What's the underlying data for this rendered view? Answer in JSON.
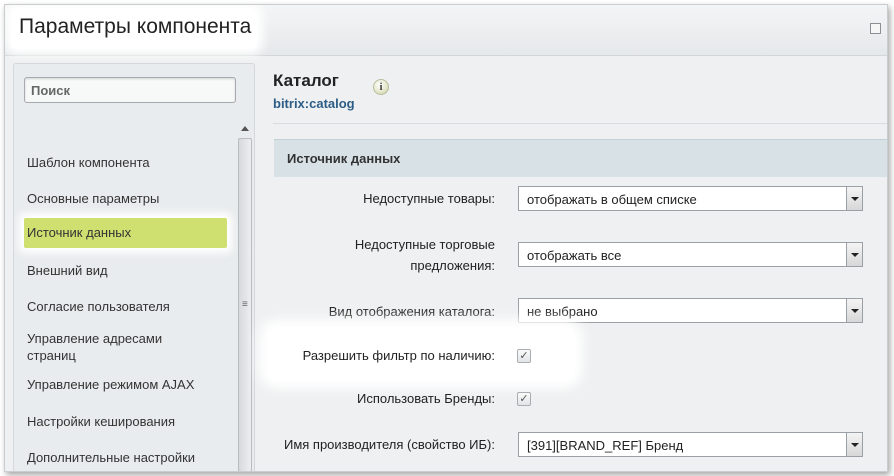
{
  "window": {
    "title": "Параметры компонента"
  },
  "sidebar": {
    "search_placeholder": "Поиск",
    "items": [
      {
        "label": "Шаблон компонента"
      },
      {
        "label": "Основные параметры"
      },
      {
        "label": "Источник данных",
        "active": true
      },
      {
        "label": "Внешний вид"
      },
      {
        "label": "Согласие пользователя"
      },
      {
        "label": "Управление адресами страниц"
      },
      {
        "label": "Управление режимом AJAX"
      },
      {
        "label": "Настройки кеширования"
      },
      {
        "label": "Дополнительные настройки"
      }
    ],
    "scroll_grip_icon": "≡"
  },
  "component": {
    "title": "Каталог",
    "code": "bitrix:catalog",
    "info_icon_glyph": "i"
  },
  "section": {
    "title": "Источник данных"
  },
  "fields": {
    "unavailable_goods": {
      "label": "Недоступные товары:",
      "value": "отображать в общем списке"
    },
    "unavailable_offers": {
      "label_line1": "Недоступные торговые",
      "label_line2": "предложения:",
      "value": "отображать все"
    },
    "catalog_view": {
      "label": "Вид отображения каталога:",
      "value": "не выбрано"
    },
    "allow_filter": {
      "label": "Разрешить фильтр по наличию:",
      "checked": true
    },
    "use_brands": {
      "label": "Использовать Бренды:",
      "checked": true
    },
    "manufacturer": {
      "label": "Имя производителя (свойство ИБ):",
      "value": "[391][BRAND_REF] Бренд"
    }
  },
  "colors": {
    "active_item": "#cfe070",
    "section_bg": "#d8e1e6",
    "code_link": "#2c5d86"
  }
}
